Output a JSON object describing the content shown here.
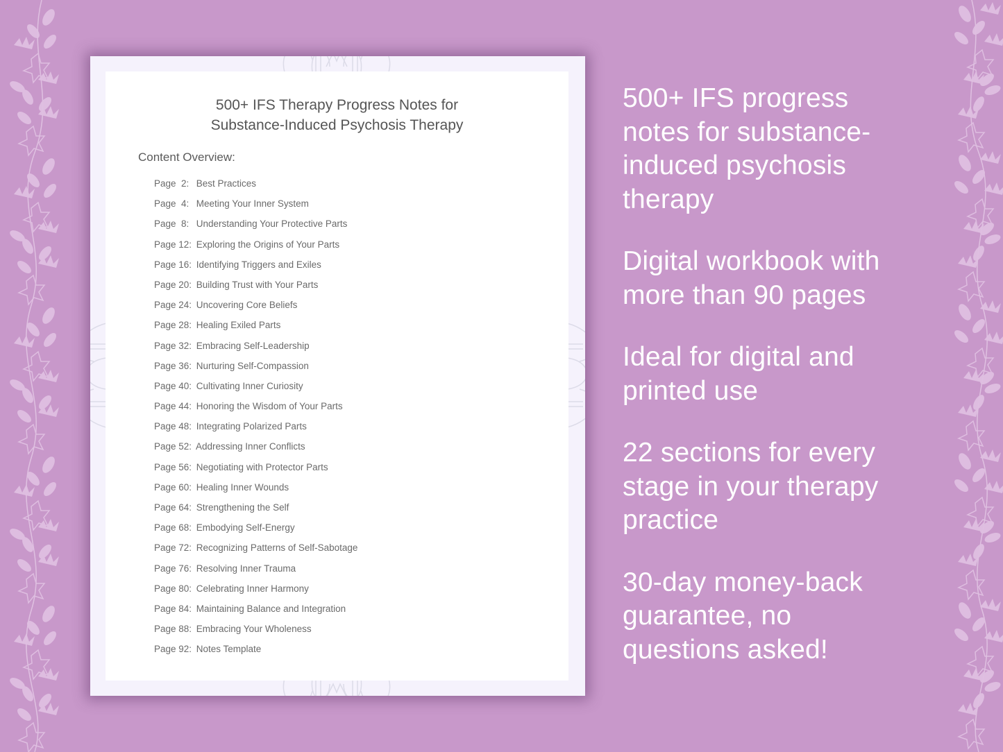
{
  "colors": {
    "background": "#c898ca",
    "document_frame": "#f5f2fc",
    "document_page": "#ffffff",
    "document_text": "#555555",
    "feature_text": "#ffffff",
    "ornament": "#ffffff"
  },
  "document": {
    "title_line1": "500+ IFS Therapy Progress Notes for",
    "title_line2": "Substance-Induced Psychosis Therapy",
    "overview_label": "Content Overview:",
    "toc": [
      {
        "page": "Page  2:",
        "title": "Best Practices"
      },
      {
        "page": "Page  4:",
        "title": "Meeting Your Inner System"
      },
      {
        "page": "Page  8:",
        "title": "Understanding Your Protective Parts"
      },
      {
        "page": "Page 12:",
        "title": "Exploring the Origins of Your Parts"
      },
      {
        "page": "Page 16:",
        "title": "Identifying Triggers and Exiles"
      },
      {
        "page": "Page 20:",
        "title": "Building Trust with Your Parts"
      },
      {
        "page": "Page 24:",
        "title": "Uncovering Core Beliefs"
      },
      {
        "page": "Page 28:",
        "title": "Healing Exiled Parts"
      },
      {
        "page": "Page 32:",
        "title": "Embracing Self-Leadership"
      },
      {
        "page": "Page 36:",
        "title": "Nurturing Self-Compassion"
      },
      {
        "page": "Page 40:",
        "title": "Cultivating Inner Curiosity"
      },
      {
        "page": "Page 44:",
        "title": "Honoring the Wisdom of Your Parts"
      },
      {
        "page": "Page 48:",
        "title": "Integrating Polarized Parts"
      },
      {
        "page": "Page 52:",
        "title": "Addressing Inner Conflicts"
      },
      {
        "page": "Page 56:",
        "title": "Negotiating with Protector Parts"
      },
      {
        "page": "Page 60:",
        "title": "Healing Inner Wounds"
      },
      {
        "page": "Page 64:",
        "title": "Strengthening the Self"
      },
      {
        "page": "Page 68:",
        "title": "Embodying Self-Energy"
      },
      {
        "page": "Page 72:",
        "title": "Recognizing Patterns of Self-Sabotage"
      },
      {
        "page": "Page 76:",
        "title": "Resolving Inner Trauma"
      },
      {
        "page": "Page 80:",
        "title": "Celebrating Inner Harmony"
      },
      {
        "page": "Page 84:",
        "title": "Maintaining Balance and Integration"
      },
      {
        "page": "Page 88:",
        "title": "Embracing Your Wholeness"
      },
      {
        "page": "Page 92:",
        "title": "Notes Template"
      }
    ]
  },
  "features": [
    {
      "line1": "500+ IFS progress",
      "line2": "notes for substance-",
      "line3": "induced psychosis",
      "line4": "therapy"
    },
    {
      "line1": "Digital workbook with",
      "line2": "more than 90 pages"
    },
    {
      "line1": "Ideal for digital and",
      "line2": "printed use"
    },
    {
      "line1": "22 sections for every",
      "line2": "stage in your therapy",
      "line3": "practice"
    },
    {
      "line1": "30-day money-back",
      "line2": "guarantee, no",
      "line3": "questions asked!"
    }
  ],
  "decorations": {
    "left_border": "floral-vine",
    "right_border": "floral-vine",
    "page_edges": "mandala"
  }
}
